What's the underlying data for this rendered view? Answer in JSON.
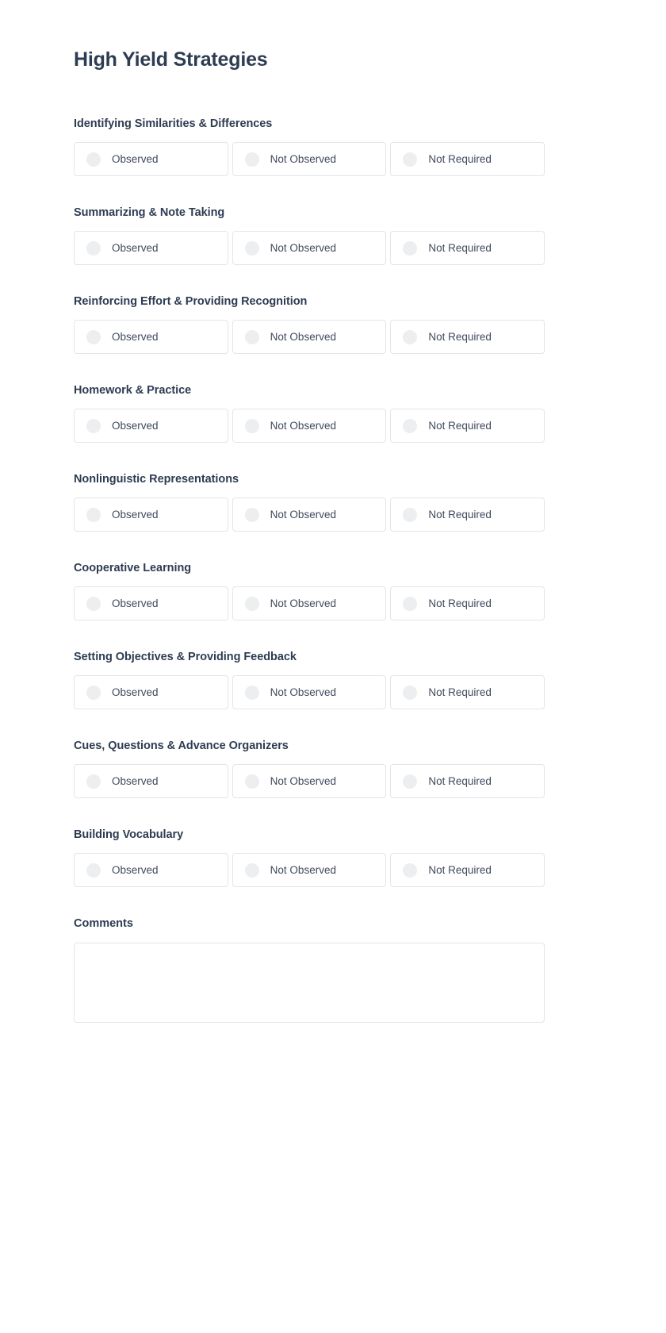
{
  "page": {
    "title": "High Yield Strategies",
    "accent_color": "#2e3c52",
    "border_color": "#e3e5e9",
    "radio_color": "#eceef0"
  },
  "options": {
    "observed": "Observed",
    "not_observed": "Not Observed",
    "not_required": "Not Required"
  },
  "questions": [
    {
      "title": "Identifying Similarities & Differences"
    },
    {
      "title": "Summarizing & Note Taking"
    },
    {
      "title": "Reinforcing Effort & Providing Recognition"
    },
    {
      "title": "Homework & Practice"
    },
    {
      "title": "Nonlinguistic Representations"
    },
    {
      "title": "Cooperative Learning"
    },
    {
      "title": "Setting Objectives & Providing Feedback"
    },
    {
      "title": "Cues, Questions & Advance Organizers"
    },
    {
      "title": "Building Vocabulary"
    }
  ],
  "comments": {
    "title": "Comments",
    "value": "",
    "placeholder": ""
  }
}
